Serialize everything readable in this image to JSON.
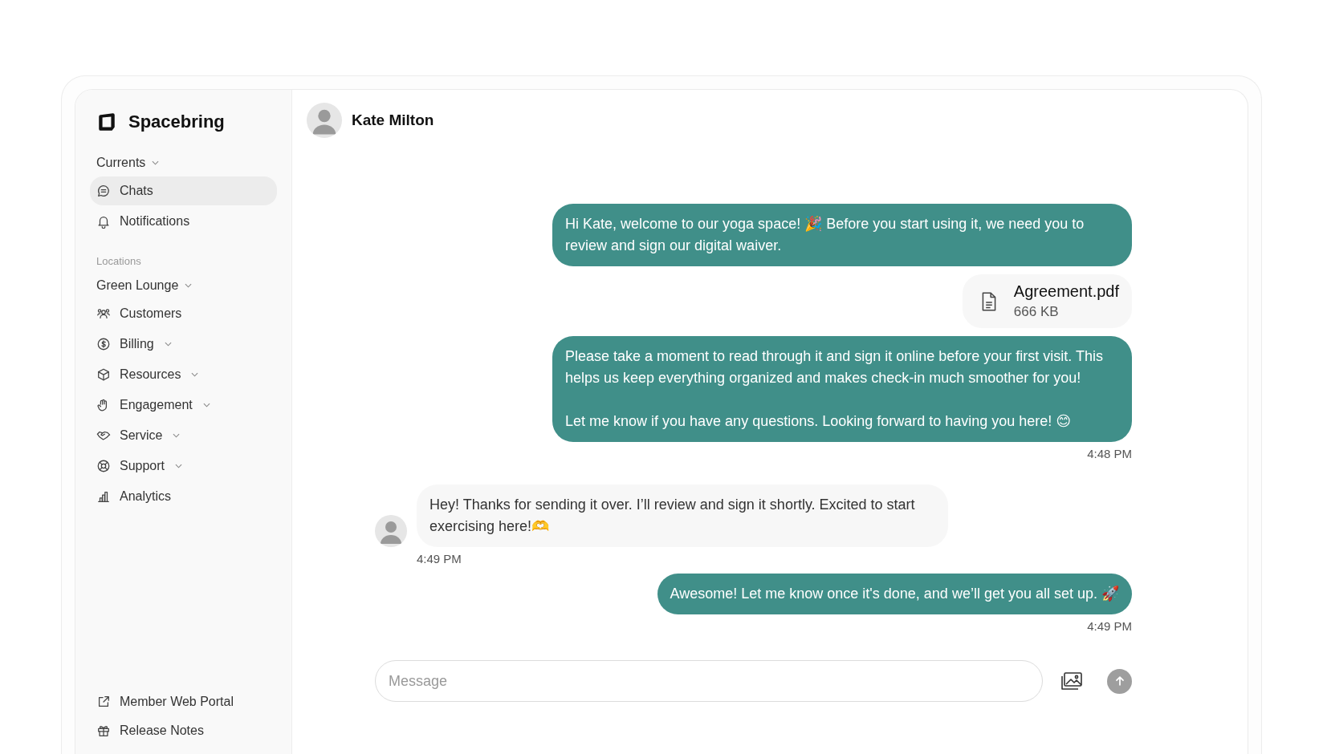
{
  "sidebar": {
    "brand": "Spacebring",
    "items": [
      {
        "kind": "group",
        "label": "Currents",
        "dropdown": true
      },
      {
        "kind": "link",
        "label": "Chats",
        "selected": true,
        "dropdown": false
      },
      {
        "kind": "link",
        "label": "Notifications",
        "selected": false,
        "dropdown": false
      },
      {
        "kind": "section",
        "label": "Locations"
      },
      {
        "kind": "group",
        "label": "Green Lounge",
        "dropdown": true
      },
      {
        "kind": "link",
        "label": "Customers",
        "selected": false,
        "dropdown": false
      },
      {
        "kind": "link",
        "label": "Billing",
        "selected": false,
        "dropdown": true
      },
      {
        "kind": "link",
        "label": "Resources",
        "selected": false,
        "dropdown": true
      },
      {
        "kind": "link",
        "label": "Engagement",
        "selected": false,
        "dropdown": true
      },
      {
        "kind": "link",
        "label": "Service",
        "selected": false,
        "dropdown": true
      },
      {
        "kind": "link",
        "label": "Support",
        "selected": false,
        "dropdown": true
      },
      {
        "kind": "link",
        "label": "Analytics",
        "selected": false,
        "dropdown": false
      }
    ],
    "footer": [
      {
        "label": "Member Web Portal"
      },
      {
        "label": "Release Notes"
      }
    ]
  },
  "chat": {
    "contact": "Kate Milton",
    "messages": [
      {
        "kind": "text",
        "outgoing": true,
        "text": "Hi Kate, welcome to our yoga space! 🎉 Before you start using it, we need you to review and sign our digital waiver."
      },
      {
        "kind": "file",
        "outgoing": true,
        "name": "Agreement.pdf",
        "size": "666 KB"
      },
      {
        "kind": "text",
        "outgoing": true,
        "text": "Please take a moment to read through it and sign it online before your first visit. This helps us keep everything organized and makes check-in much smoother for you!\n\nLet me know if you have any questions. Looking forward to having you here! 😊"
      },
      {
        "kind": "time",
        "outgoing": true,
        "text": "4:48 PM"
      },
      {
        "kind": "text",
        "outgoing": false,
        "text": "Hey! Thanks for sending it over. I’ll review and sign it shortly. Excited to start exercising here!🫶"
      },
      {
        "kind": "time",
        "outgoing": false,
        "text": "4:49 PM"
      },
      {
        "kind": "text",
        "outgoing": true,
        "text": "Awesome! Let me know once it's done, and we’ll get you all set up. 🚀"
      },
      {
        "kind": "time",
        "outgoing": true,
        "text": "4:49 PM"
      }
    ],
    "composer": {
      "placeholder": "Message"
    }
  }
}
